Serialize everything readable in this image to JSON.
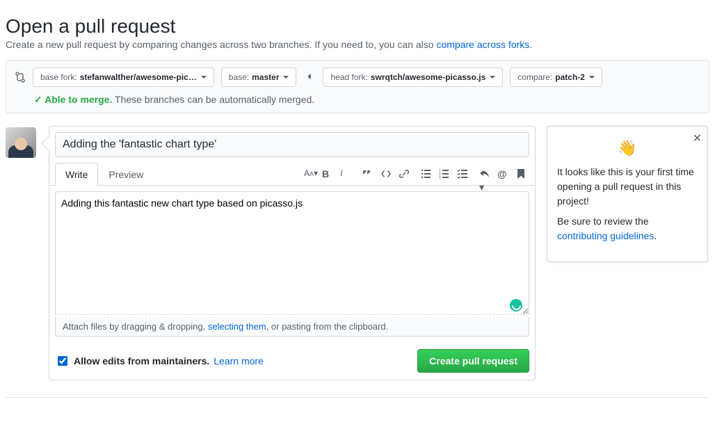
{
  "header": {
    "title": "Open a pull request",
    "subtitle_pre": "Create a new pull request by comparing changes across two branches. If you need to, you can also ",
    "subtitle_link": "compare across forks",
    "subtitle_post": "."
  },
  "range": {
    "base_fork_label": "base fork: ",
    "base_fork_value": "stefanwalther/awesome-pic…",
    "base_label": "base: ",
    "base_value": "master",
    "head_fork_label": "head fork: ",
    "head_fork_value": "swrqtch/awesome-picasso.js",
    "compare_label": "compare: ",
    "compare_value": "patch-2"
  },
  "merge": {
    "check_icon": "✓",
    "status": "Able to merge.",
    "message": "These branches can be automatically merged."
  },
  "form": {
    "title_value": "Adding the 'fantastic chart type'",
    "tabs": {
      "write": "Write",
      "preview": "Preview"
    },
    "body_value": "Adding this fantastic new chart type based on picasso.js",
    "drag_pre": "Attach files by dragging & dropping, ",
    "drag_link": "selecting them",
    "drag_post": ", or pasting from the clipboard.",
    "allow_edits_label": "Allow edits from maintainers.",
    "learn_more": "Learn more",
    "submit": "Create pull request"
  },
  "tip": {
    "wave": "👋",
    "p1": "It looks like this is your first time opening a pull request in this project!",
    "p2_pre": "Be sure to review the ",
    "p2_link": "contributing guidelines",
    "p2_post": "."
  }
}
